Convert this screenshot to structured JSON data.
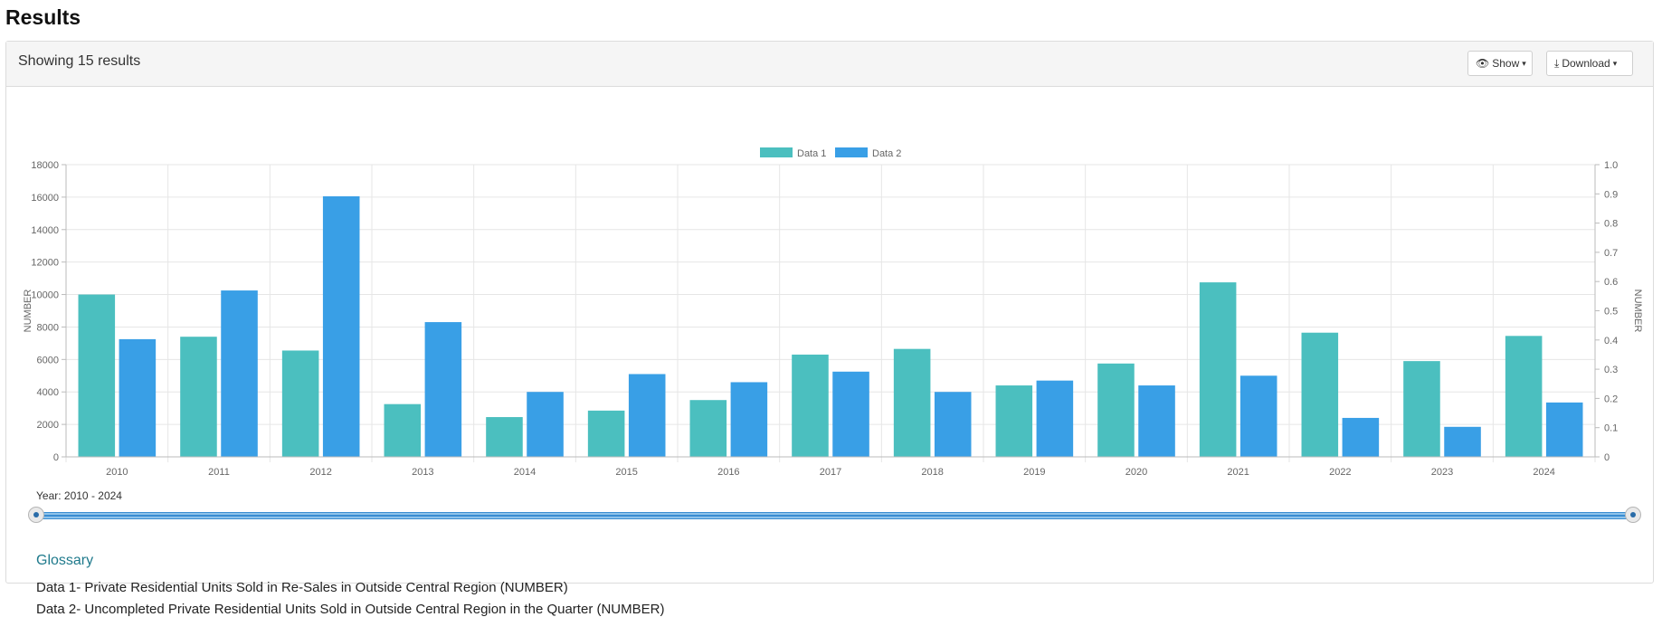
{
  "page": {
    "title": "Results"
  },
  "panel": {
    "results_count": "Showing 15 results",
    "show_label": "Show",
    "download_label": "Download"
  },
  "icons": {
    "show": "eye-icon",
    "download": "download-icon",
    "caret": "caret-down-icon"
  },
  "chart_data": {
    "type": "bar",
    "categories": [
      "2010",
      "2011",
      "2012",
      "2013",
      "2014",
      "2015",
      "2016",
      "2017",
      "2018",
      "2019",
      "2020",
      "2021",
      "2022",
      "2023",
      "2024"
    ],
    "series": [
      {
        "name": "Data 1",
        "color": "#4bbfbf",
        "values": [
          10000,
          7400,
          6550,
          3250,
          2450,
          2850,
          3500,
          6300,
          6650,
          4400,
          5750,
          10750,
          7650,
          5900,
          7450
        ]
      },
      {
        "name": "Data 2",
        "color": "#399fe6",
        "values": [
          7250,
          10250,
          16050,
          8300,
          4000,
          5100,
          4600,
          5250,
          4000,
          4700,
          4400,
          5000,
          2400,
          1850,
          3350
        ]
      }
    ],
    "ylabel": "NUMBER",
    "y2label": "NUMBER",
    "ylim": [
      0,
      18000
    ],
    "y2lim": [
      0,
      1.0
    ],
    "yticks": [
      "0",
      "2000",
      "4000",
      "6000",
      "8000",
      "10000",
      "12000",
      "14000",
      "16000",
      "18000"
    ],
    "y2ticks": [
      "0",
      "0.1",
      "0.2",
      "0.3",
      "0.4",
      "0.5",
      "0.6",
      "0.7",
      "0.8",
      "0.9",
      "1.0"
    ],
    "grid": true,
    "legend": "top-center"
  },
  "slider": {
    "label": "Year: 2010 - 2024"
  },
  "glossary": {
    "title": "Glossary",
    "items": [
      "Data 1- Private Residential Units Sold in Re-Sales in Outside Central Region (NUMBER)",
      "Data 2- Uncompleted Private Residential Units Sold in Outside Central Region in the Quarter (NUMBER)"
    ]
  }
}
